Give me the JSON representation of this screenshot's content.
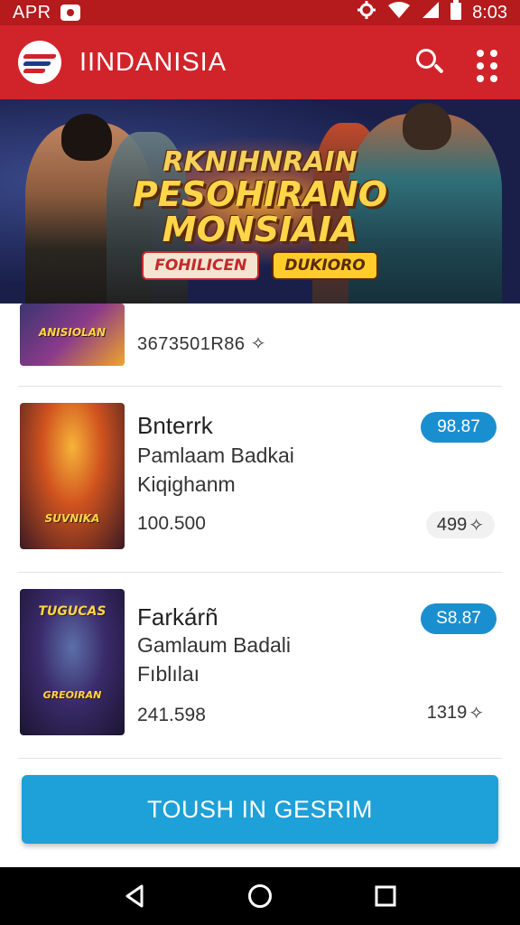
{
  "status_bar": {
    "carrier": "APR",
    "time": "8:03"
  },
  "app_bar": {
    "title": "IINDANISIA"
  },
  "banner": {
    "line1": "RKNIHNRAIN",
    "line2": "PESOHIRANO",
    "line3": "MONSIAIA",
    "tag_left": "FOHILICEN",
    "tag_right": "DUKIORO"
  },
  "items": [
    {
      "thumb_text": "ANISIOLAN",
      "code": "3673501R86"
    },
    {
      "thumb_text": "SUVNIKA",
      "name": "Bnterrk",
      "subtitle_line1": "Pamlaam Badkai",
      "subtitle_line2": "Kiqighanm",
      "count": "100.500",
      "price": "98.87",
      "rating": "499"
    },
    {
      "thumb_text": "TUGUCAS",
      "thumb_text2": "GREOIRAN",
      "name": "Farkárñ",
      "subtitle_line1": "Gamlaum Badali",
      "subtitle_line2": "Fıblılaı",
      "count": "241.598",
      "price": "S8.87",
      "rating": "1319"
    }
  ],
  "cta": {
    "label": "TOUSH IN GESRIM"
  },
  "colors": {
    "app_bar": "#d0242a",
    "status_bar": "#b51a1d",
    "accent_blue": "#1ea0d8",
    "price_pill": "#1a8fd0"
  }
}
